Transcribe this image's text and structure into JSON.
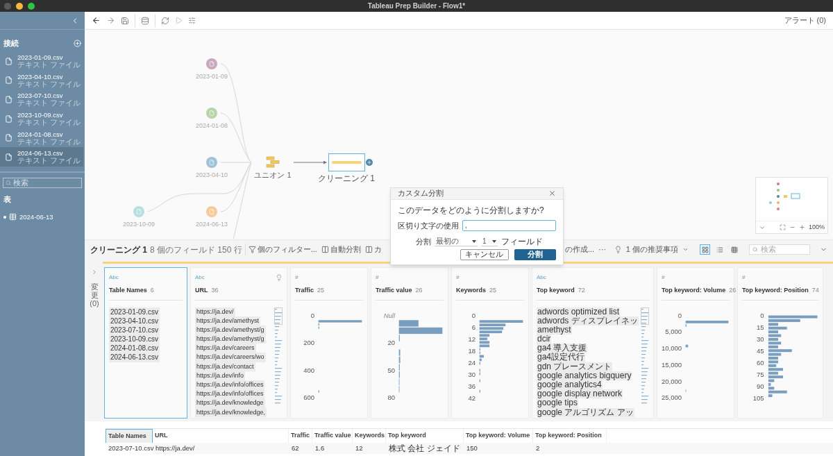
{
  "window": {
    "title": "Tableau Prep Builder - Flow1*"
  },
  "sidebar": {
    "header": "接続",
    "connections": [
      {
        "name": "2023-01-09.csv",
        "type": "テキスト ファイル",
        "selected": false
      },
      {
        "name": "2023-04-10.csv",
        "type": "テキスト ファイル",
        "selected": false
      },
      {
        "name": "2023-07-10.csv",
        "type": "テキスト ファイル",
        "selected": false
      },
      {
        "name": "2023-10-09.csv",
        "type": "テキスト ファイル",
        "selected": false
      },
      {
        "name": "2024-01-08.csv",
        "type": "テキスト ファイル",
        "selected": false
      },
      {
        "name": "2024-06-13.csv",
        "type": "テキスト ファイル",
        "selected": true
      }
    ],
    "search": {
      "placeholder": "検索"
    },
    "tables_header": "表",
    "tables": [
      {
        "name": "2024-06-13"
      }
    ]
  },
  "toolbar": {
    "alerts": "アラート (0)"
  },
  "flow": {
    "inputs": [
      {
        "label": "2023-01-09",
        "color": "#c9a9bc"
      },
      {
        "label": "2024-01-08",
        "color": "#b9d4a8"
      },
      {
        "label": "2023-04-10",
        "color": "#9fc3d6"
      },
      {
        "label": "2023-10-09",
        "color": "#b7dfe0"
      },
      {
        "label": "2024-06-13",
        "color": "#f9c99a"
      }
    ],
    "union": {
      "label": "ユニオン 1"
    },
    "clean": {
      "label": "クリーニング 1",
      "selected": true
    }
  },
  "minimap": {
    "zoom": "100%"
  },
  "dialog": {
    "title": "カスタム分割",
    "question": "このデータをどのように分割しますか?",
    "delimiter_label": "区切り文字の使用",
    "delimiter_value": ",",
    "split_label": "分割",
    "split_mode": "最初の",
    "split_count": "1",
    "fields_label": "フィールド",
    "cancel": "キャンセル",
    "ok": "分割"
  },
  "step_bar": {
    "name": "クリーニング 1",
    "meta": "8 個のフィールド 150 行",
    "actions": [
      {
        "label": "個のフィルター...",
        "kind": "filter"
      },
      {
        "label": "自動分割",
        "kind": "split"
      },
      {
        "label": "カ",
        "kind": "split"
      },
      {
        "label": "の作成...",
        "kind": "plain"
      },
      {
        "label": "···",
        "kind": "plain"
      }
    ],
    "recommendations": "1 個の推奨事項",
    "views": [
      {
        "kind": "profile",
        "selected": true
      },
      {
        "kind": "list",
        "selected": false
      },
      {
        "kind": "grid",
        "selected": false
      }
    ],
    "search": {
      "placeholder": "検索"
    }
  },
  "changes": {
    "label": "変更",
    "count": "(0)"
  },
  "profile_cards": [
    {
      "type_label": "Abc",
      "name": "Table Names",
      "count": "6",
      "selected": true,
      "hint": false,
      "kind": "values",
      "values": [
        "2023-01-09.csv",
        "2023-04-10.csv",
        "2023-07-10.csv",
        "2023-10-09.csv",
        "2024-01-08.csv",
        "2024-06-13.csv"
      ]
    },
    {
      "type_label": "Abc",
      "name": "URL",
      "count": "36",
      "selected": false,
      "hint": true,
      "kind": "values",
      "values": [
        "https://ja.dev/",
        "https://ja.dev/amethyst",
        "https://ja.dev/amethyst/g",
        "https://ja.dev/amethyst/g",
        "https://ja.dev/careers",
        "https://ja.dev/careers/wo",
        "https://ja.dev/contact",
        "https://ja.dev/info",
        "https://ja.dev/info/offices",
        "https://ja.dev/info/offices",
        "https://ja.dev/knowledge",
        "https://ja.dev/knowledge,"
      ]
    },
    {
      "type_label": "#",
      "name": "Traffic",
      "count": "25",
      "selected": false,
      "hint": false,
      "kind": "histogram",
      "axis_labels": [
        {
          "text": "0",
          "italic": false
        },
        {
          "text": "200",
          "italic": false
        },
        {
          "text": "400",
          "italic": false
        },
        {
          "text": "600",
          "italic": false
        }
      ]
    },
    {
      "type_label": "#",
      "name": "Traffic value",
      "count": "26",
      "selected": false,
      "hint": false,
      "kind": "histogram",
      "axis_labels": [
        {
          "text": "Null",
          "italic": true
        },
        {
          "text": "20",
          "italic": false
        },
        {
          "text": "50",
          "italic": false
        },
        {
          "text": "80",
          "italic": false
        }
      ]
    },
    {
      "type_label": "#",
      "name": "Keywords",
      "count": "25",
      "selected": false,
      "hint": false,
      "kind": "histogram",
      "axis_labels": [
        {
          "text": "0",
          "italic": false
        },
        {
          "text": "6",
          "italic": false
        },
        {
          "text": "12",
          "italic": false
        },
        {
          "text": "18",
          "italic": false
        },
        {
          "text": "24",
          "italic": false
        },
        {
          "text": "30",
          "italic": false
        },
        {
          "text": "36",
          "italic": false
        },
        {
          "text": "42",
          "italic": false
        }
      ]
    },
    {
      "type_label": "Abc",
      "name": "Top keyword",
      "count": "72",
      "selected": false,
      "hint": false,
      "kind": "values",
      "values": [
        "adwords optimized list",
        "adwords ディスプレイネッ",
        "amethyst",
        "dcir",
        "ga4 導入支援",
        "ga4設定代行",
        "gdn プレースメント",
        "google analytics bigquery",
        "google analytics4",
        "google display network",
        "google tips",
        "google アルゴリズム アッ"
      ]
    },
    {
      "type_label": "#",
      "name": "Top keyword: Volume",
      "count": "26",
      "selected": false,
      "hint": false,
      "kind": "histogram",
      "axis_labels": [
        {
          "text": "0",
          "italic": false
        },
        {
          "text": "5,000",
          "italic": false
        },
        {
          "text": "10,000",
          "italic": false
        },
        {
          "text": "15,000",
          "italic": false
        },
        {
          "text": "20,000",
          "italic": false
        },
        {
          "text": "25,000",
          "italic": false
        }
      ]
    },
    {
      "type_label": "#",
      "name": "Top keyword: Position",
      "count": "74",
      "selected": false,
      "hint": false,
      "kind": "histogram",
      "axis_labels": [
        {
          "text": "0",
          "italic": false
        },
        {
          "text": "15",
          "italic": false
        },
        {
          "text": "30",
          "italic": false
        },
        {
          "text": "45",
          "italic": false
        },
        {
          "text": "60",
          "italic": false
        },
        {
          "text": "75",
          "italic": false
        },
        {
          "text": "90",
          "italic": false
        },
        {
          "text": "105",
          "italic": false
        }
      ]
    }
  ],
  "table": {
    "columns": [
      {
        "label": "Table Names",
        "selected": true
      },
      {
        "label": "URL",
        "selected": false
      },
      {
        "label": "Traffic",
        "selected": false
      },
      {
        "label": "Traffic value",
        "selected": false
      },
      {
        "label": "Keywords",
        "selected": false
      },
      {
        "label": "Top keyword",
        "selected": false
      },
      {
        "label": "Top keyword: Volume",
        "selected": false
      },
      {
        "label": "Top keyword: Position",
        "selected": false
      }
    ],
    "rows": [
      [
        "2023-07-10.csv",
        "https://ja.dev/",
        "62",
        "1.6",
        "12",
        "株式 会社 ジェイド",
        "150",
        "2"
      ]
    ]
  }
}
